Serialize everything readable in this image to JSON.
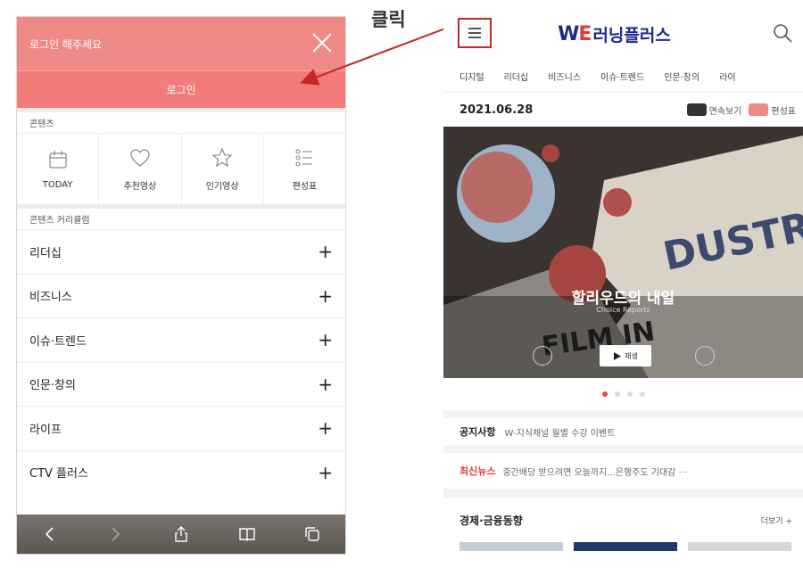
{
  "annotation": {
    "label": "클릭",
    "color": "#c62828"
  },
  "menu": {
    "login_prompt": "로그인 해주세요",
    "login_button": "로그인",
    "contents_section": "콘텐츠",
    "contents_items": [
      {
        "label": "TODAY",
        "icon": "calendar-icon"
      },
      {
        "label": "추천영상",
        "icon": "heart-icon"
      },
      {
        "label": "인기영상",
        "icon": "star-icon"
      },
      {
        "label": "편성표",
        "icon": "list-icon"
      }
    ],
    "curriculum_section": "콘텐츠 커리큘럼",
    "curriculum_items": [
      "리더십",
      "비즈니스",
      "이슈·트렌드",
      "인문·창의",
      "라이프",
      "CTV 플러스"
    ],
    "expand_symbol": "+",
    "accent": "#f08a86"
  },
  "home": {
    "logo_mark": "WE",
    "logo_text": "러닝플러스",
    "tabs": [
      "디지털",
      "리더십",
      "비즈니스",
      "이슈·트렌드",
      "인문·창의",
      "라이"
    ],
    "date": "2021.06.28",
    "continuous_label": "연속보기",
    "schedule_label": "편성표",
    "banner": {
      "title": "할리우드의 내일",
      "subtitle": "Choice Reports",
      "play_label": "재생",
      "art_text_1": "DUSTRY",
      "art_text_2": "FILM IN"
    },
    "notice_label": "공지사항",
    "notice_text": "W-지식채널 월별 수강 이벤트",
    "news_label": "최신뉴스",
    "news_text": "중간배당 받으려면 오늘까지...은행주도 기대감 ···",
    "econ_label": "경제·금융동향",
    "more_label": "더보기 +",
    "brand_color": "#1d2b8f",
    "red": "#e53935"
  }
}
